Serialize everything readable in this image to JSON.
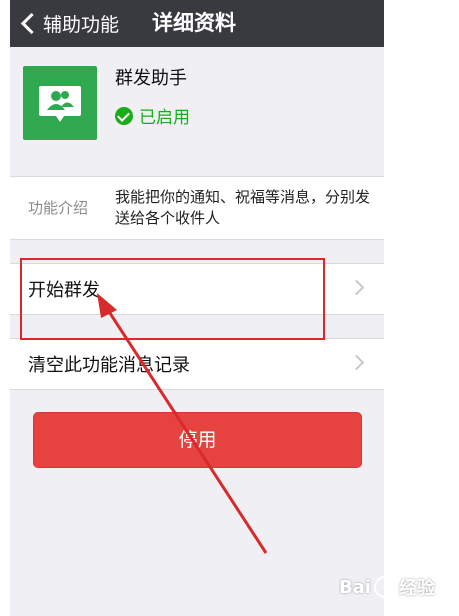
{
  "navbar": {
    "back_label": "辅助功能",
    "title": "详细资料"
  },
  "app": {
    "name": "群发助手",
    "status": "已启用",
    "icon": "group-chat-icon",
    "icon_color": "#2fa84f"
  },
  "intro": {
    "label": "功能介绍",
    "text": "我能把你的通知、祝福等消息，分别发送给各个收件人"
  },
  "rows": [
    {
      "label": "开始群发"
    },
    {
      "label": "清空此功能消息记录"
    }
  ],
  "stop_button": {
    "label": "停用",
    "color": "#e64340"
  },
  "watermark": {
    "brand_left": "Bai",
    "brand_right": "经验"
  },
  "annotation_color": "#d82a2a"
}
